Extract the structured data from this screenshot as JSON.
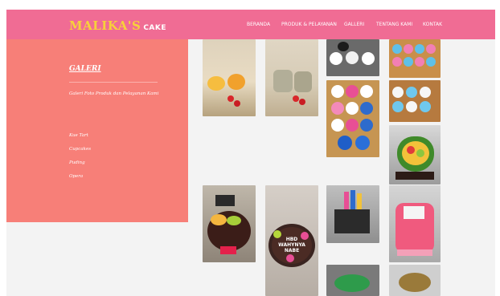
{
  "brand": {
    "name": "MALIKA'S",
    "suffix": "CAKE"
  },
  "nav": {
    "items": [
      "BERANDA",
      "PRODUK & PELAYANAN",
      "GALLERI",
      "TENTANG KAMI",
      "KONTAK"
    ]
  },
  "sidebar": {
    "title": "GALERI",
    "subtitle": "Galeri Foto Produk dan Pelayanan Kami",
    "categories": [
      "Kue Tart",
      "Cupcakes",
      "Puding",
      "Opera"
    ]
  },
  "gallery": {
    "cake_photos": [
      {
        "icon": "pudding-cup-photo"
      },
      {
        "icon": "pudding-cup-photo"
      },
      {
        "icon": "sports-cupcakes-photo"
      },
      {
        "icon": "cupcake-box-photo"
      },
      {
        "icon": "cupcake-tray-photo"
      },
      {
        "icon": "cupcake-tray-photo"
      },
      {
        "icon": "heart-cake-photo"
      },
      {
        "icon": "fruit-cake-photo"
      },
      {
        "icon": "birthday-cake-photo"
      },
      {
        "icon": "tall-cake-photo"
      },
      {
        "icon": "cake-photo"
      },
      {
        "icon": "cake-photo"
      },
      {
        "icon": "cake-photo"
      }
    ],
    "topper_photo": {
      "icon": "cake-topper-photo",
      "lines": [
        "HBD",
        "WAHYNYA",
        "NABE"
      ]
    }
  },
  "colors": {
    "navbar": "#f06c94",
    "brand": "#f7d13a",
    "sidebar": "#f77f78",
    "background": "#f3f3f3"
  }
}
